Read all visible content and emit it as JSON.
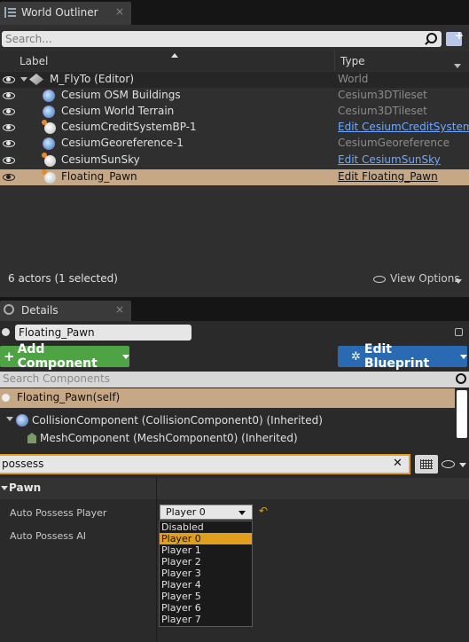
{
  "outliner": {
    "tab_title": "World Outliner",
    "tab_close": "×",
    "search_placeholder": "Search...",
    "col_label": "Label",
    "col_type": "Type",
    "rows": [
      {
        "label": "M_FlyTo (Editor)",
        "type": "World",
        "type_link": false
      },
      {
        "label": "Cesium OSM Buildings",
        "type": "Cesium3DTileset",
        "type_link": false
      },
      {
        "label": "Cesium World Terrain",
        "type": "Cesium3DTileset",
        "type_link": false
      },
      {
        "label": "CesiumCreditSystemBP-1",
        "type": "Edit CesiumCreditSystem",
        "type_link": true
      },
      {
        "label": "CesiumGeoreference-1",
        "type": "CesiumGeoreference",
        "type_link": false
      },
      {
        "label": "CesiumSunSky",
        "type": "Edit CesiumSunSky",
        "type_link": true
      },
      {
        "label": "Floating_Pawn",
        "type": "Edit Floating_Pawn",
        "type_link": true,
        "selected": true
      }
    ],
    "status": "6 actors (1 selected)",
    "view_options": "View Options"
  },
  "details": {
    "tab_title": "Details",
    "tab_close": "×",
    "name_value": "Floating_Pawn",
    "add_component": "Add Component",
    "edit_blueprint": "Edit Blueprint",
    "search_components_placeholder": "Search Components",
    "components": [
      {
        "label": "Floating_Pawn(self)"
      },
      {
        "label": "CollisionComponent (CollisionComponent0) (Inherited)"
      },
      {
        "label": "MeshComponent (MeshComponent0) (Inherited)"
      }
    ],
    "filter_value": "possess",
    "filter_clear": "✕",
    "section": "Pawn",
    "props": [
      {
        "label": "Auto Possess Player",
        "value": "Player 0"
      },
      {
        "label": "Auto Possess AI"
      }
    ],
    "reset_icon": "↶",
    "dropdown_options": [
      "Disabled",
      "Player 0",
      "Player 1",
      "Player 2",
      "Player 3",
      "Player 4",
      "Player 5",
      "Player 6",
      "Player 7"
    ],
    "dropdown_highlight_index": 1
  },
  "colors": {
    "selection": "#c7a886",
    "green_button": "#4ea345",
    "blue_button": "#2a6ab3",
    "highlight": "#e0a01e",
    "link": "#6fa8ff"
  }
}
